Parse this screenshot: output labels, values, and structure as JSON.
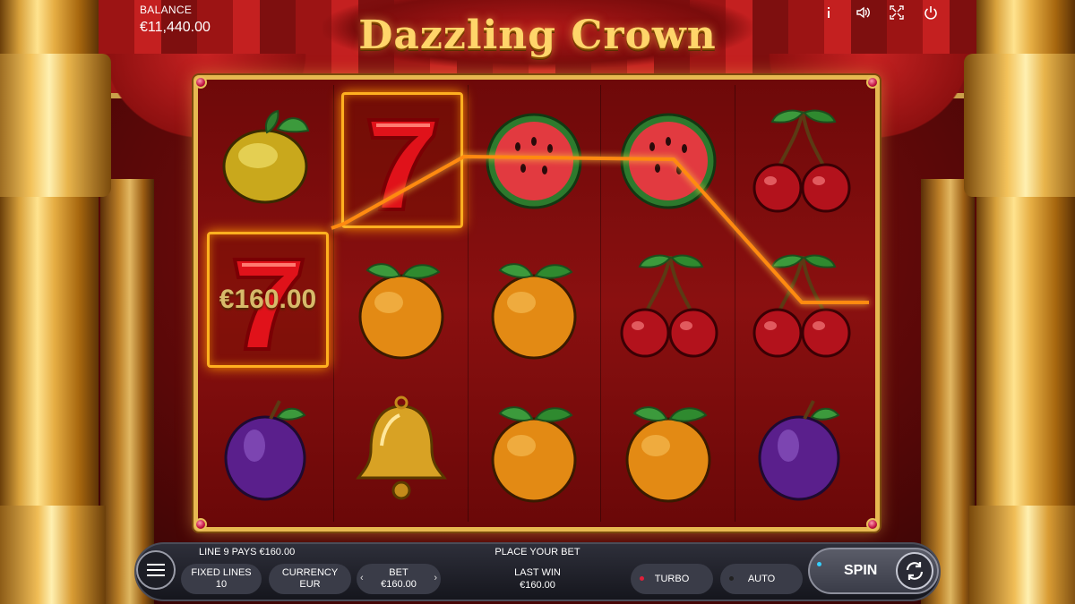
{
  "game": {
    "title": "Dazzling Crown"
  },
  "header": {
    "balance_label": "BALANCE",
    "balance_value": "€11,440.00"
  },
  "top_icons": [
    "info-icon",
    "sound-icon",
    "fullscreen-icon",
    "power-icon"
  ],
  "reels": [
    [
      "lemon",
      "seven",
      "plum"
    ],
    [
      "seven",
      "orange",
      "bell"
    ],
    [
      "watermelon",
      "orange",
      "orange"
    ],
    [
      "watermelon",
      "cherry",
      "orange"
    ],
    [
      "cherry",
      "cherry",
      "plum"
    ]
  ],
  "win": {
    "amount_label": "€160.00",
    "line_info": "LINE 9 PAYS €160.00"
  },
  "bottom_bar": {
    "status_message": "PLACE YOUR BET",
    "fixed_lines_label": "FIXED LINES",
    "fixed_lines_value": "10",
    "currency_label": "CURRENCY",
    "currency_value": "EUR",
    "bet_label": "BET",
    "bet_value": "€160.00",
    "last_win_label": "LAST WIN",
    "last_win_value": "€160.00",
    "turbo_label": "TURBO",
    "auto_label": "AUTO",
    "spin_label": "SPIN"
  },
  "colors": {
    "accent_gold": "#e7b851",
    "win_highlight": "#ffb020",
    "turbo_dot": "#e0203a",
    "spin_dot": "#35d0ff"
  }
}
